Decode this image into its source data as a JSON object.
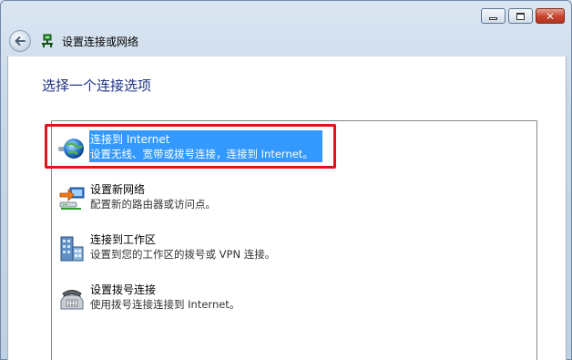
{
  "window": {
    "title": "设置连接或网络",
    "controls": [
      "minimize",
      "maximize",
      "close"
    ]
  },
  "page": {
    "heading": "选择一个连接选项"
  },
  "options": [
    {
      "title": "连接到 Internet",
      "description": "设置无线、宽带或拨号连接，连接到 Internet。",
      "icon": "globe-network-icon",
      "selected": true
    },
    {
      "title": "设置新网络",
      "description": "配置新的路由器或访问点。",
      "icon": "new-network-icon",
      "selected": false
    },
    {
      "title": "连接到工作区",
      "description": "设置到您的工作区的拨号或 VPN 连接。",
      "icon": "workplace-icon",
      "selected": false
    },
    {
      "title": "设置拨号连接",
      "description": "使用拨号连接连接到 Internet。",
      "icon": "dialup-phone-icon",
      "selected": false
    }
  ],
  "colors": {
    "heading": "#1e3287",
    "selection": "#3399ff",
    "annotation_box": "#e0151b"
  }
}
